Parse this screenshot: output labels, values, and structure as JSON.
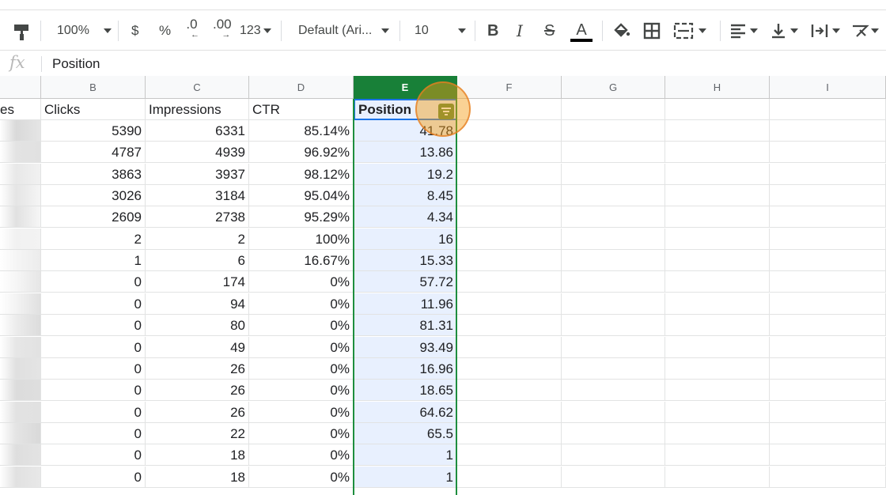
{
  "toolbar": {
    "zoom": "100%",
    "currency": "$",
    "percent": "%",
    "decrease_decimal": ".0",
    "increase_decimal": ".00",
    "more_formats": "123",
    "font_family": "Default (Ari...",
    "font_size": "10",
    "bold": "B",
    "italic": "I",
    "strikethrough": "S",
    "text_color": "A"
  },
  "formula_bar": {
    "fx": "fx",
    "value": "Position"
  },
  "columns": [
    "B",
    "C",
    "D",
    "E",
    "F",
    "G",
    "H",
    "I"
  ],
  "partial_header_a": "es",
  "headers": {
    "clicks": "Clicks",
    "impressions": "Impressions",
    "ctr": "CTR",
    "position": "Position"
  },
  "rows": [
    {
      "clicks": "5390",
      "impressions": "6331",
      "ctr": "85.14%",
      "position": "41.78"
    },
    {
      "clicks": "4787",
      "impressions": "4939",
      "ctr": "96.92%",
      "position": "13.86"
    },
    {
      "clicks": "3863",
      "impressions": "3937",
      "ctr": "98.12%",
      "position": "19.2"
    },
    {
      "clicks": "3026",
      "impressions": "3184",
      "ctr": "95.04%",
      "position": "8.45"
    },
    {
      "clicks": "2609",
      "impressions": "2738",
      "ctr": "95.29%",
      "position": "4.34"
    },
    {
      "clicks": "2",
      "impressions": "2",
      "ctr": "100%",
      "position": "16"
    },
    {
      "clicks": "1",
      "impressions": "6",
      "ctr": "16.67%",
      "position": "15.33"
    },
    {
      "clicks": "0",
      "impressions": "174",
      "ctr": "0%",
      "position": "57.72"
    },
    {
      "clicks": "0",
      "impressions": "94",
      "ctr": "0%",
      "position": "11.96"
    },
    {
      "clicks": "0",
      "impressions": "80",
      "ctr": "0%",
      "position": "81.31"
    },
    {
      "clicks": "0",
      "impressions": "49",
      "ctr": "0%",
      "position": "93.49"
    },
    {
      "clicks": "0",
      "impressions": "26",
      "ctr": "0%",
      "position": "16.96"
    },
    {
      "clicks": "0",
      "impressions": "26",
      "ctr": "0%",
      "position": "18.65"
    },
    {
      "clicks": "0",
      "impressions": "26",
      "ctr": "0%",
      "position": "64.62"
    },
    {
      "clicks": "0",
      "impressions": "22",
      "ctr": "0%",
      "position": "65.5"
    },
    {
      "clicks": "0",
      "impressions": "18",
      "ctr": "0%",
      "position": "1"
    },
    {
      "clicks": "0",
      "impressions": "18",
      "ctr": "0%",
      "position": "1"
    }
  ],
  "colors": {
    "selected_header": "#188038",
    "selected_column_fill": "#e8f0fe",
    "active_cell_border": "#1a73e8",
    "highlight": "#f39c12"
  }
}
